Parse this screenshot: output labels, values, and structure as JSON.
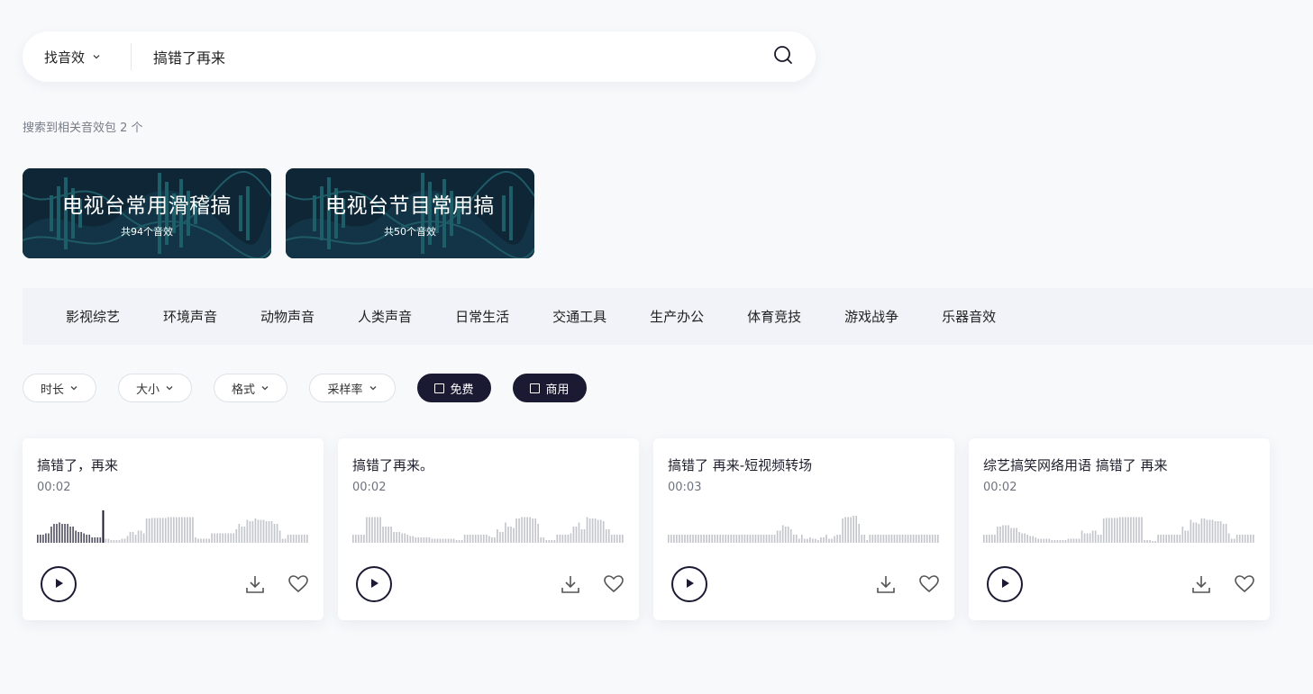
{
  "search": {
    "category_label": "找音效",
    "query": "搞错了再来",
    "icons": {
      "category_chevron": "chevron-down-icon",
      "submit": "search-icon"
    }
  },
  "result_summary": "搜索到相关音效包 2 个",
  "packs": [
    {
      "title": "电视台常用滑稽搞",
      "count_label": "共94个音效"
    },
    {
      "title": "电视台节目常用搞",
      "count_label": "共50个音效"
    }
  ],
  "categories": [
    "影视综艺",
    "环境声音",
    "动物声音",
    "人类声音",
    "日常生活",
    "交通工具",
    "生产办公",
    "体育竞技",
    "游戏战争",
    "乐器音效"
  ],
  "filters": {
    "duration": "时长",
    "size": "大小",
    "format": "格式",
    "sample_rate": "采样率",
    "free": "免费",
    "commercial": "商用"
  },
  "sounds": [
    {
      "title": "搞错了，再来",
      "duration": "00:02",
      "progress": 0.24,
      "actions": [
        "play-icon",
        "download-icon",
        "heart-icon"
      ]
    },
    {
      "title": "搞错了再来。",
      "duration": "00:02",
      "progress": 0,
      "actions": [
        "play-icon",
        "download-icon",
        "heart-icon"
      ]
    },
    {
      "title": "搞错了 再来-短视频转场",
      "duration": "00:03",
      "progress": 0,
      "actions": [
        "play-icon",
        "download-icon",
        "heart-icon"
      ]
    },
    {
      "title": "综艺搞笑网络用语 搞错了 再来",
      "duration": "00:02",
      "progress": 0,
      "actions": [
        "play-icon",
        "download-icon",
        "heart-icon"
      ]
    }
  ],
  "colors": {
    "accent_dark": "#1a1a33",
    "wave_played": "#555566",
    "wave_unplayed": "#c4c6cc",
    "pack_bg": "#0f2a3a",
    "pack_wave": "#1f5a66"
  }
}
